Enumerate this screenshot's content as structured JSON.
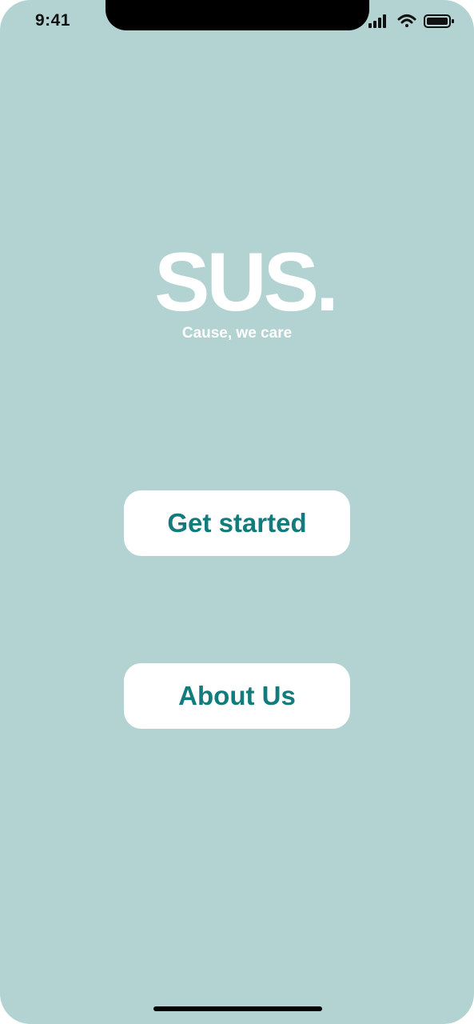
{
  "status_bar": {
    "time": "9:41",
    "icons": [
      "signal-icon",
      "wifi-icon",
      "battery-icon"
    ]
  },
  "brand": {
    "title": "SUS.",
    "tagline": "Cause, we care"
  },
  "buttons": {
    "get_started": "Get started",
    "about_us": "About Us"
  },
  "colors": {
    "background": "#b3d3d3",
    "button_bg": "#ffffff",
    "button_text": "#137b7b",
    "brand_text": "#ffffff"
  }
}
